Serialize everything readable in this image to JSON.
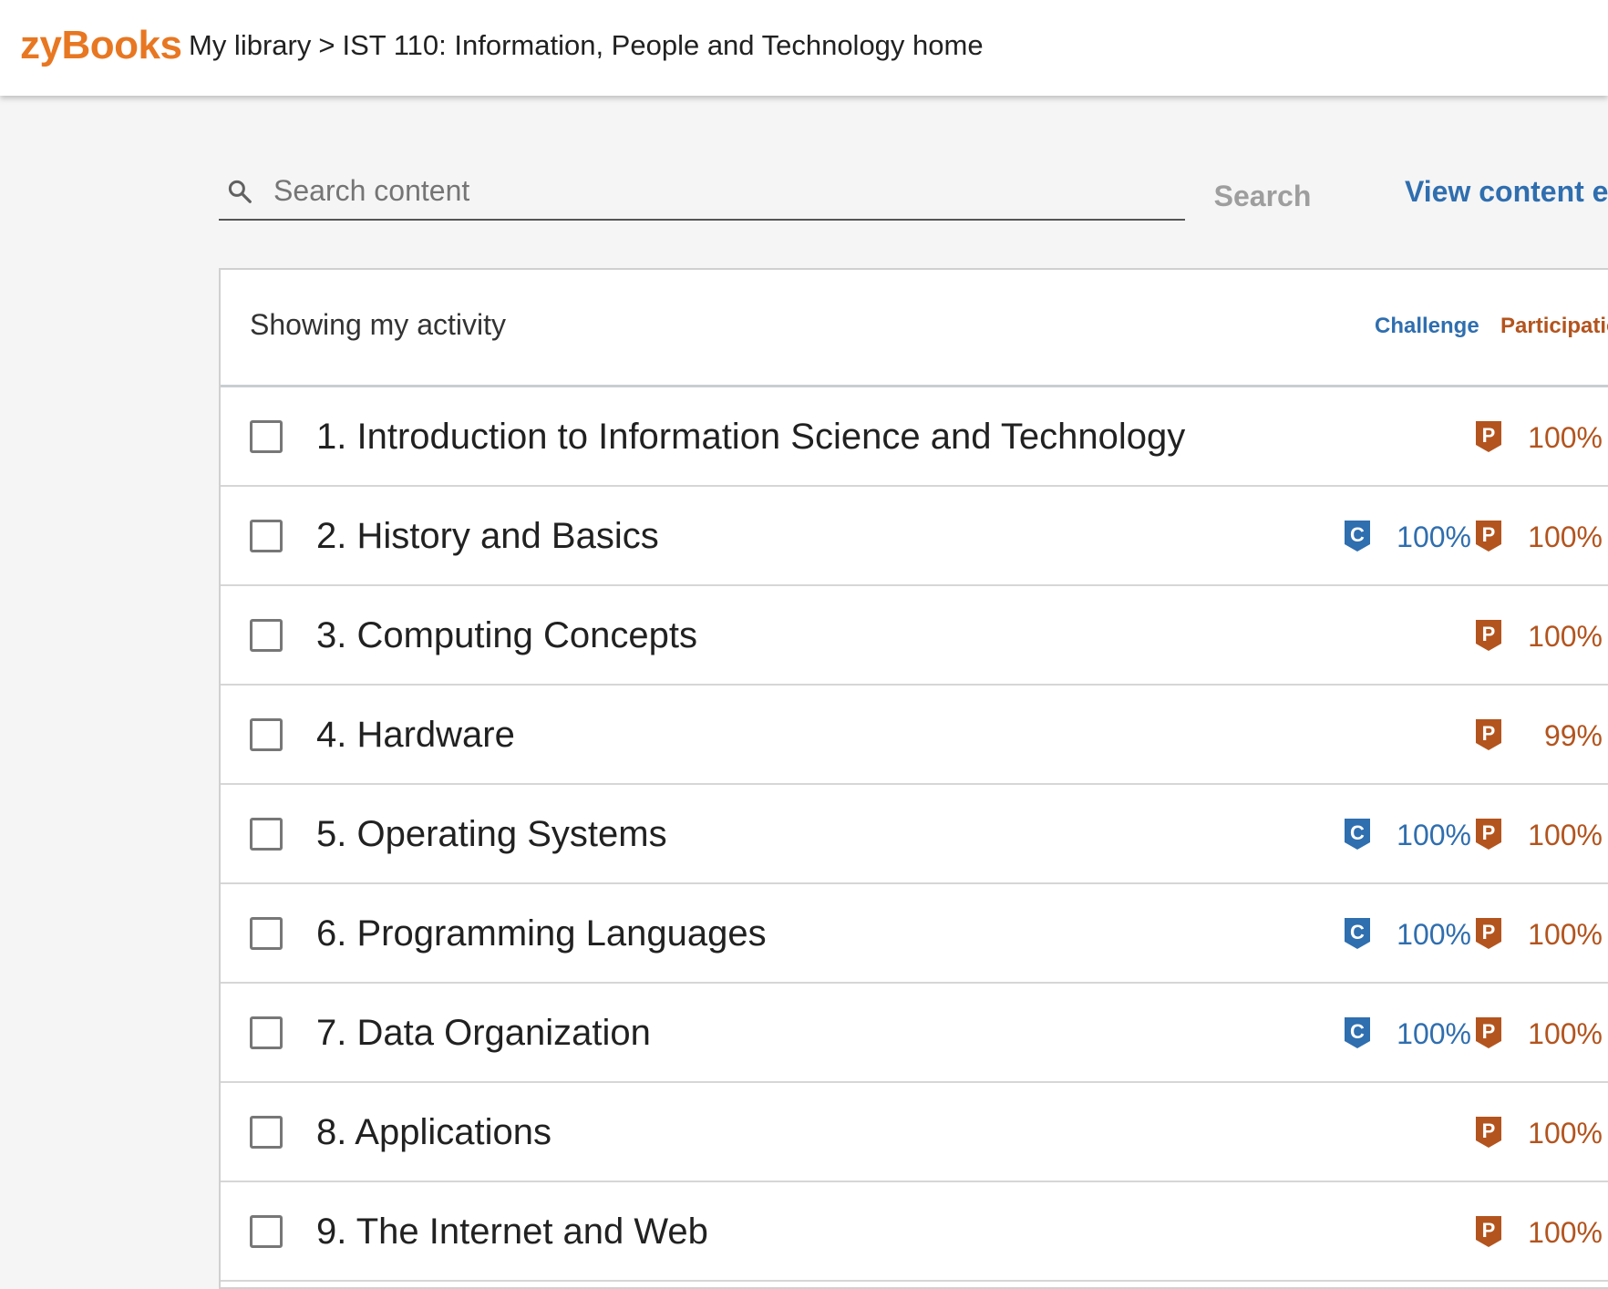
{
  "header": {
    "logo": "zyBooks",
    "breadcrumb": {
      "library": "My library",
      "separator": ">",
      "current": "IST 110: Information, People and Technology home"
    }
  },
  "search": {
    "placeholder": "Search content",
    "button_label": "Search",
    "view_link": "View content ex"
  },
  "activity": {
    "title": "Showing my activity",
    "legend": {
      "challenge": "Challenge",
      "participation": "Participatio"
    }
  },
  "colors": {
    "brand": "#e87722",
    "challenge": "#2f6eaf",
    "participation": "#b3541e"
  },
  "badge_letters": {
    "challenge": "C",
    "participation": "P"
  },
  "chapters": [
    {
      "title": "1. Introduction to Information Science and Technology",
      "challenge": "",
      "participation": "100%"
    },
    {
      "title": "2. History and Basics",
      "challenge": "100%",
      "participation": "100%"
    },
    {
      "title": "3. Computing Concepts",
      "challenge": "",
      "participation": "100%"
    },
    {
      "title": "4. Hardware",
      "challenge": "",
      "participation": "99%"
    },
    {
      "title": "5. Operating Systems",
      "challenge": "100%",
      "participation": "100%"
    },
    {
      "title": "6. Programming Languages",
      "challenge": "100%",
      "participation": "100%"
    },
    {
      "title": "7. Data Organization",
      "challenge": "100%",
      "participation": "100%"
    },
    {
      "title": "8. Applications",
      "challenge": "",
      "participation": "100%"
    },
    {
      "title": "9. The Internet and Web",
      "challenge": "",
      "participation": "100%"
    }
  ]
}
